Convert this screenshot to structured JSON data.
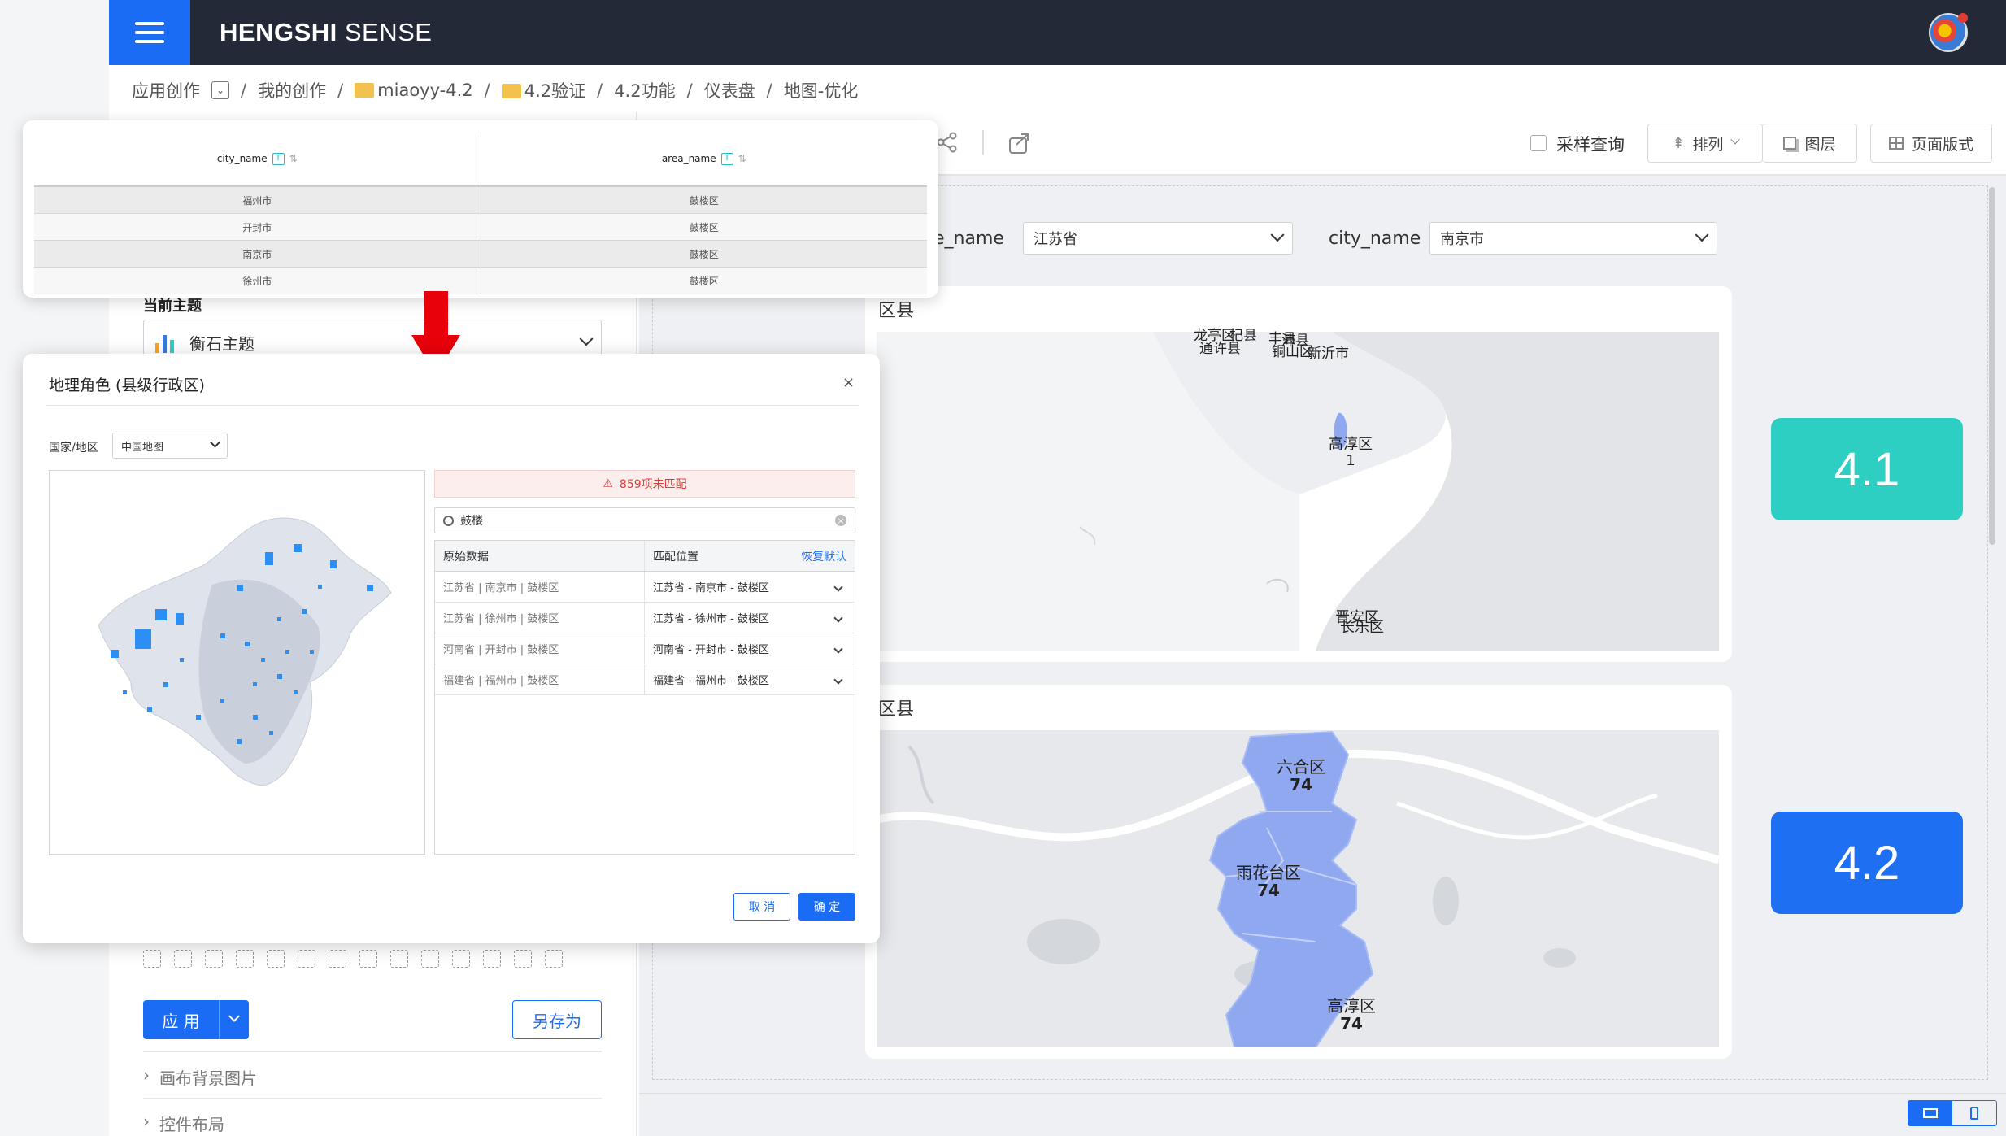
{
  "app": {
    "brand_bold": "HENGSHI",
    "brand_light": " SENSE"
  },
  "breadcrumb": {
    "root": "应用创作",
    "items": [
      "我的创作",
      "miaoyy-4.2",
      "4.2验证",
      "4.2功能",
      "仪表盘",
      "地图-优化"
    ],
    "sep": "/"
  },
  "toolbar": {
    "sample_query": "采样查询",
    "arrange": "排列",
    "layers": "图层",
    "page_style": "页面版式"
  },
  "left_panel": {
    "theme_heading": "当前主题",
    "theme_value": "衡石主题",
    "apply": "应 用",
    "save_as": "另存为",
    "canvas_bg": "画布背景图片",
    "control_layout": "控件布局"
  },
  "filters": {
    "province_label": "e_name",
    "province_value": "江苏省",
    "city_label": "city_name",
    "city_value": "南京市"
  },
  "map_cards": [
    {
      "title": "区县",
      "labels": [
        {
          "text": "龙亭区",
          "sub": ""
        },
        {
          "text": "通许县",
          "sub": ""
        },
        {
          "text": "杞县",
          "sub": ""
        },
        {
          "text": "丰县",
          "sub": ""
        },
        {
          "text": "沛县",
          "sub": ""
        },
        {
          "text": "铜山区",
          "sub": ""
        },
        {
          "text": "新沂市",
          "sub": ""
        },
        {
          "text": "高淳区",
          "sub": "1"
        },
        {
          "text": "晋安区",
          "sub": ""
        },
        {
          "text": "长乐区",
          "sub": ""
        }
      ]
    },
    {
      "title": "区县",
      "labels": [
        {
          "text": "六合区",
          "sub": "74"
        },
        {
          "text": "雨花台区",
          "sub": "74"
        },
        {
          "text": "高淳区",
          "sub": "74"
        }
      ]
    }
  ],
  "kpis": [
    {
      "value": "4.1",
      "color": "#2dcfc3"
    },
    {
      "value": "4.2",
      "color": "#1f6ff2"
    }
  ],
  "table_popup": {
    "columns": [
      "city_name",
      "area_name"
    ],
    "type_badge": "T",
    "rows": [
      [
        "福州市",
        "鼓楼区"
      ],
      [
        "开封市",
        "鼓楼区"
      ],
      [
        "南京市",
        "鼓楼区"
      ],
      [
        "徐州市",
        "鼓楼区"
      ]
    ]
  },
  "dialog": {
    "title": "地理角色 (县级行政区)",
    "close": "×",
    "country_label": "国家/地区",
    "country_value": "中国地图",
    "unmatched": "859项未匹配",
    "search_value": "鼓楼",
    "col_source": "原始数据",
    "col_match": "匹配位置",
    "restore_default": "恢复默认",
    "rows": [
      {
        "source": "江苏省 | 南京市 | 鼓楼区",
        "match": "江苏省 - 南京市 - 鼓楼区"
      },
      {
        "source": "江苏省 | 徐州市 | 鼓楼区",
        "match": "江苏省 - 徐州市 - 鼓楼区"
      },
      {
        "source": "河南省 | 开封市 | 鼓楼区",
        "match": "河南省 - 开封市 - 鼓楼区"
      },
      {
        "source": "福建省 | 福州市 | 鼓楼区",
        "match": "福建省 - 福州市 - 鼓楼区"
      }
    ],
    "cancel": "取 消",
    "ok": "确 定"
  },
  "colors": {
    "accent": "#1a6cf5",
    "topbar": "#242938",
    "map_fill": "#8fa8f0",
    "alert_red": "#e8000b"
  }
}
